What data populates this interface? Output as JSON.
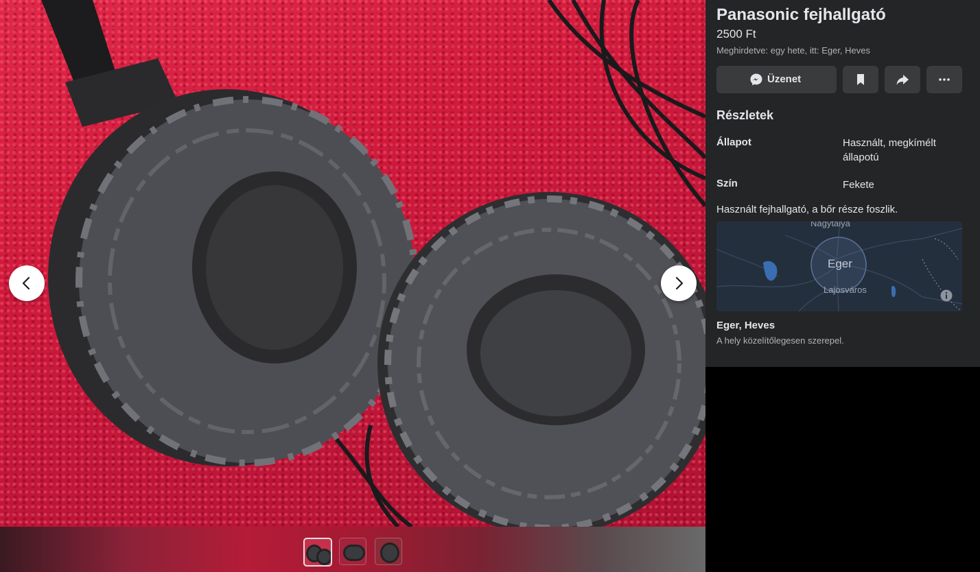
{
  "listing": {
    "title": "Panasonic fejhallgató",
    "price": "2500 Ft",
    "posted": "Meghirdetve: egy hete, itt: Eger, Heves"
  },
  "actions": {
    "message_label": "Üzenet",
    "icons": [
      "messenger-icon",
      "bookmark-icon",
      "share-icon",
      "more-icon"
    ]
  },
  "details": {
    "heading": "Részletek",
    "rows": [
      {
        "label": "Állapot",
        "value": "Használt, megkímélt állapotú"
      },
      {
        "label": "Szín",
        "value": "Fekete"
      }
    ],
    "description": "Használt fejhallgató, a bőr része foszlik."
  },
  "map": {
    "city": "Eger",
    "towns": [
      "Nagytálya",
      "Lajosváros"
    ]
  },
  "location": {
    "name": "Eger, Heves",
    "note": "A hely közelítőlegesen szerepel."
  },
  "gallery": {
    "photo_count": 3,
    "active_index": 0
  },
  "colors": {
    "panel_bg": "#242526",
    "button_bg": "#3a3b3c",
    "text_primary": "#e4e6eb",
    "text_secondary": "#b0b3b8"
  }
}
